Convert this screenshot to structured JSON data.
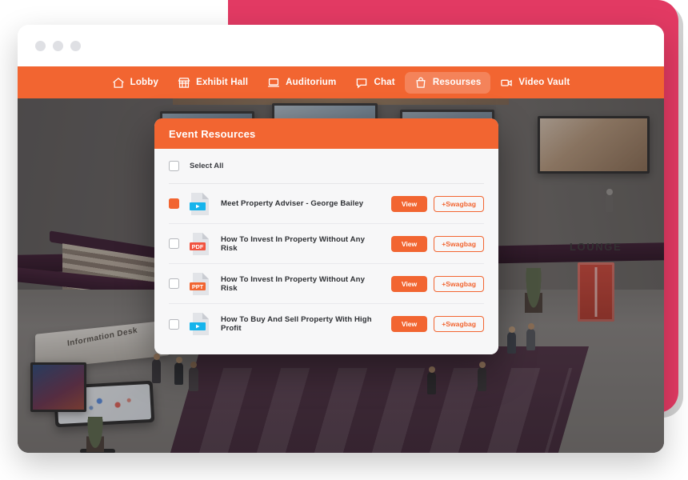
{
  "window": {
    "dots": [
      "window-dot-1",
      "window-dot-2",
      "window-dot-3"
    ]
  },
  "nav": {
    "items": [
      {
        "label": "Lobby",
        "icon": "home-icon",
        "active": false
      },
      {
        "label": "Exhibit Hall",
        "icon": "store-icon",
        "active": false
      },
      {
        "label": "Auditorium",
        "icon": "laptop-icon",
        "active": false
      },
      {
        "label": "Chat",
        "icon": "chat-bubble-icon",
        "active": false
      },
      {
        "label": "Resourses",
        "icon": "bag-icon",
        "active": true
      },
      {
        "label": "Video Vault",
        "icon": "video-camera-icon",
        "active": false
      }
    ]
  },
  "venue": {
    "information_desk_label": "Information Desk",
    "lounge_sign": "LOUNGE"
  },
  "modal": {
    "title": "Event Resources",
    "select_all_label": "Select All",
    "select_all_checked": false,
    "view_label": "View",
    "swagbag_label": "+Swagbag",
    "resources": [
      {
        "title": "Meet Property Adviser - George Bailey",
        "type": "video",
        "type_label": "",
        "checked": true
      },
      {
        "title": "How To Invest In Property Without Any Risk",
        "type": "pdf",
        "type_label": "PDF",
        "checked": false
      },
      {
        "title": "How To Invest In Property Without Any Risk",
        "type": "ppt",
        "type_label": "PPT",
        "checked": false
      },
      {
        "title": "How To Buy And Sell Property With High Profit",
        "type": "video",
        "type_label": "",
        "checked": false
      }
    ]
  },
  "colors": {
    "brand_orange": "#f26531",
    "accent_pink": "#e23a63",
    "video_blue": "#16b4ec",
    "pdf_red": "#f2533f",
    "ppt_orange": "#f26531"
  }
}
